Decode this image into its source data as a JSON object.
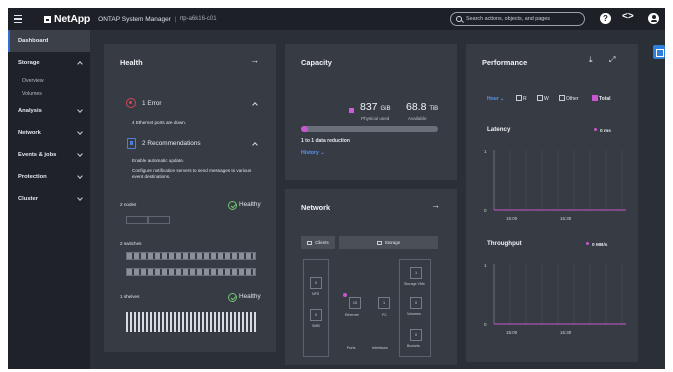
{
  "topbar": {
    "brand": "NetApp",
    "app_title": "ONTAP System Manager",
    "separator": "|",
    "cluster": "rtp-a6k16-c01",
    "search_placeholder": "Search actions, objects, and pages"
  },
  "sidebar": {
    "items": [
      {
        "label": "Dashboard",
        "active": true
      },
      {
        "label": "Storage",
        "expanded": true
      },
      {
        "label": "Analysis"
      },
      {
        "label": "Network"
      },
      {
        "label": "Events & jobs"
      },
      {
        "label": "Protection"
      },
      {
        "label": "Cluster"
      }
    ],
    "storage_sub": [
      "Overview",
      "Volumes"
    ]
  },
  "health": {
    "title": "Health",
    "error_title": "1 Error",
    "error_detail": "4 Ethernet ports are down.",
    "rec_title": "2 Recommendations",
    "rec_1": "Enable automatic update.",
    "rec_2": "Configure notification servers to send messages to various event destinations.",
    "nodes_label": "2 nodes",
    "switches_label": "2 switches",
    "shelves_label": "1 shelves",
    "healthy": "Healthy"
  },
  "capacity": {
    "title": "Capacity",
    "used_value": "837",
    "used_unit": "GiB",
    "used_label": "Physical used",
    "available_value": "68.8",
    "available_unit": "TiB",
    "available_label": "Available",
    "used_fraction": 0.05,
    "reduction": "1 to 1 data reduction",
    "history": "History"
  },
  "network": {
    "title": "Network",
    "tab_clients": "Clients",
    "tab_storage": "Storage",
    "col_labels": [
      "NFS",
      "SMB",
      "Ethernet",
      "FC",
      "Storage VMs",
      "Volumes",
      "Buckets"
    ],
    "counts": [
      "0",
      "0",
      "10",
      "1",
      "1",
      "0",
      "0"
    ],
    "footer_ports": "Ports",
    "footer_interfaces": "Interfaces"
  },
  "performance": {
    "title": "Performance",
    "range": "Hour",
    "check_r": "R",
    "check_w": "W",
    "check_other": "Other",
    "check_total": "Total",
    "latency_title": "Latency",
    "latency_value": "0 ms",
    "throughput_title": "Throughput",
    "throughput_value": "0 MB/s",
    "y_top": "1",
    "y_bottom": "0",
    "x_ticks": [
      "15:00",
      "15:30"
    ]
  },
  "colors": {
    "accent": "#c956cf",
    "link": "#5b93f0",
    "error": "#d64550",
    "ok": "#6ec66e"
  }
}
